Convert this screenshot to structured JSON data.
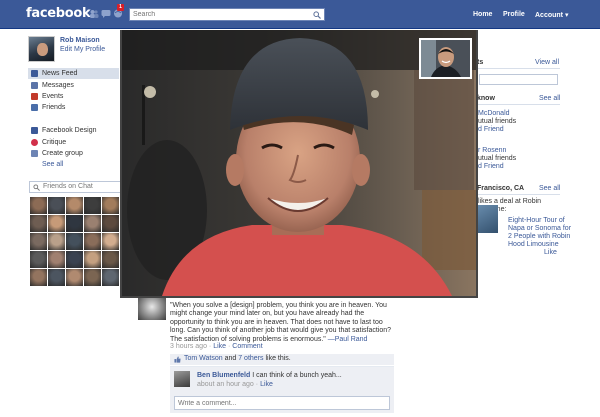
{
  "header": {
    "logo": "facebook",
    "notification_count": "1",
    "search_placeholder": "Search",
    "nav": {
      "home": "Home",
      "profile": "Profile",
      "account": "Account ▾"
    }
  },
  "left": {
    "profile_name": "Rob Maison",
    "edit_profile": "Edit My Profile",
    "nav_items": [
      {
        "label": "News Feed",
        "icon": "news-feed-icon",
        "color": "#3b5998"
      },
      {
        "label": "Messages",
        "icon": "messages-icon",
        "color": "#5b74a8"
      },
      {
        "label": "Events",
        "icon": "events-icon",
        "color": "#c23a2b"
      },
      {
        "label": "Friends",
        "icon": "friends-icon",
        "color": "#4a6ea9"
      }
    ],
    "group_items": [
      {
        "label": "Facebook Design",
        "icon": "page-icon",
        "color": "#3b5998"
      },
      {
        "label": "Critique",
        "icon": "heart-icon",
        "color": "#d1304a"
      },
      {
        "label": "Create group",
        "icon": "group-icon",
        "color": "#6d84b4"
      }
    ],
    "see_all": "See all",
    "friends_on_chat": "Friends on Chat"
  },
  "right": {
    "section1_head": "ts",
    "section1_see_all": "View all",
    "section2_head": "know",
    "section2_see_all": "See all",
    "people": [
      {
        "name": "McDonald",
        "sub": "utual friends",
        "action": "d Friend"
      },
      {
        "name": "r Rosenn",
        "sub": "utual friends",
        "action": "d Friend"
      }
    ],
    "section3_head": "Francisco, CA",
    "section3_see_all": "See all",
    "ad_line1": "likes a deal at Robin",
    "ad_line2": "mousine:",
    "ad_title": "Eight-Hour Tour of Napa or Sonoma for 2 People with Robin Hood Limousine",
    "ad_like": "Like"
  },
  "post": {
    "text": "\"When you solve a [design] problem, you think you are in heaven. You might change your mind later on, but you have already had the opportunity to think you are in heaven. That does not have to last too long. Can you think of another job that would give you that satisfaction? The satisfaction of solving problems is enormous.\"",
    "author": "—Paul Rand",
    "time": "3 hours ago",
    "sep": " · ",
    "like": "Like",
    "comment": "Comment",
    "likes_name": "Tom Watson",
    "likes_and": " and ",
    "likes_others": "7 others",
    "likes_suffix": " like this.",
    "comment_name": "Ben Blumenfeld",
    "comment_body": " I can think of a bunch yeah...",
    "comment_time": "about an hour ago",
    "comment_like": "Like",
    "comment_placeholder": "Write a comment..."
  },
  "colors": {
    "brand": "#3b5998",
    "link": "#3b5998",
    "panel": "#edeff4"
  }
}
